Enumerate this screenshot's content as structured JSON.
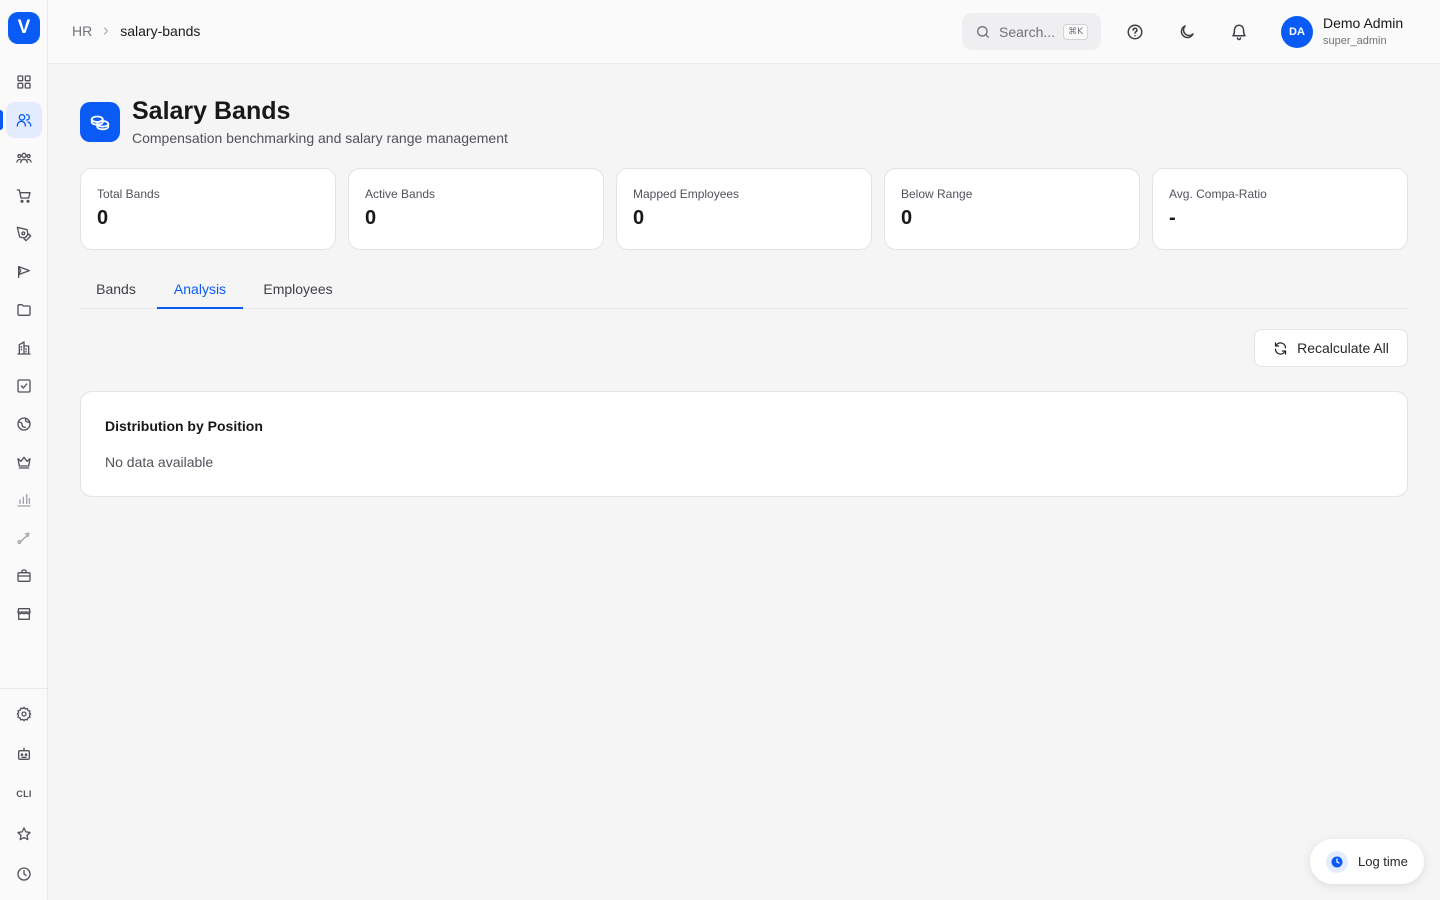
{
  "app": {
    "logo_letter": "V",
    "accent_color": "#0a5bf5"
  },
  "sidebar": {
    "items": [
      {
        "icon": "grid-icon",
        "active": false
      },
      {
        "icon": "users-icon",
        "active": true
      },
      {
        "icon": "team-icon",
        "active": false
      },
      {
        "icon": "cart-icon",
        "active": false
      },
      {
        "icon": "pen-tool-icon",
        "active": false
      },
      {
        "icon": "send-icon",
        "active": false
      },
      {
        "icon": "folder-icon",
        "active": false
      },
      {
        "icon": "building-icon",
        "active": false
      },
      {
        "icon": "checkbox-icon",
        "active": false
      },
      {
        "icon": "globe-icon",
        "active": false
      },
      {
        "icon": "crown-icon",
        "active": false
      },
      {
        "icon": "bar-chart-icon",
        "active": false
      },
      {
        "icon": "route-icon",
        "active": false
      },
      {
        "icon": "briefcase-icon",
        "active": false
      },
      {
        "icon": "store-icon",
        "active": false
      }
    ],
    "bottom_items": [
      {
        "icon": "settings-icon"
      },
      {
        "icon": "bot-icon"
      },
      {
        "icon": "cli-icon",
        "label": "CLI"
      },
      {
        "icon": "star-icon"
      },
      {
        "icon": "clock-icon"
      }
    ]
  },
  "header": {
    "breadcrumb": {
      "root": "HR",
      "current": "salary-bands"
    },
    "search": {
      "placeholder": "Search...",
      "shortcut": "⌘K"
    },
    "user": {
      "initials": "DA",
      "name": "Demo Admin",
      "role": "super_admin"
    }
  },
  "page": {
    "title": "Salary Bands",
    "subtitle": "Compensation benchmarking and salary range management"
  },
  "stats": [
    {
      "label": "Total Bands",
      "value": "0"
    },
    {
      "label": "Active Bands",
      "value": "0"
    },
    {
      "label": "Mapped Employees",
      "value": "0"
    },
    {
      "label": "Below Range",
      "value": "0"
    },
    {
      "label": "Avg. Compa-Ratio",
      "value": "-"
    }
  ],
  "tabs": [
    {
      "label": "Bands",
      "active": false
    },
    {
      "label": "Analysis",
      "active": true
    },
    {
      "label": "Employees",
      "active": false
    }
  ],
  "actions": {
    "recalculate_label": "Recalculate All"
  },
  "distribution": {
    "title": "Distribution by Position",
    "empty_text": "No data available"
  },
  "floating": {
    "log_time_label": "Log time"
  }
}
